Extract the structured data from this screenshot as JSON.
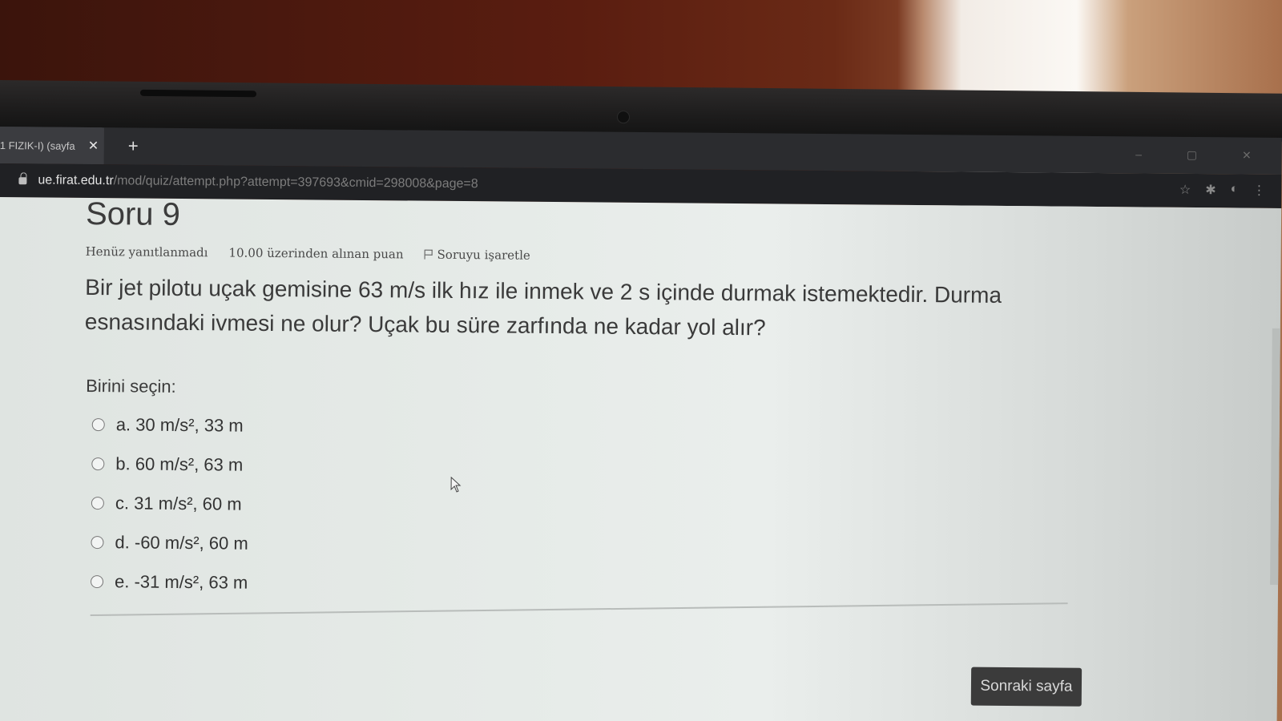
{
  "browser": {
    "tab_title": "1 FIZIK-I) (sayfa",
    "tab_close": "✕",
    "new_tab": "+",
    "url_host": "ue.firat.edu.tr",
    "url_path": "/mod/quiz/attempt.php?attempt=397693&cmid=298008&page=8"
  },
  "question": {
    "title": "Soru 9",
    "status": "Henüz yanıtlanmadı",
    "points": "10.00 üzerinden alınan puan",
    "flag_label": "Soruyu işaretle",
    "text": "Bir jet pilotu uçak gemisine 63 m/s ilk hız ile inmek ve 2 s içinde durmak istemektedir. Durma esnasındaki ivmesi ne olur? Uçak bu süre zarfında ne kadar yol alır?",
    "prompt": "Birini seçin:",
    "options": [
      "a. 30 m/s², 33 m",
      "b. 60 m/s², 63 m",
      "c. 31 m/s², 60 m",
      "d. -60 m/s², 60 m",
      "e. -31 m/s², 63 m"
    ]
  },
  "navigation": {
    "next_label": "Sonraki sayfa"
  }
}
